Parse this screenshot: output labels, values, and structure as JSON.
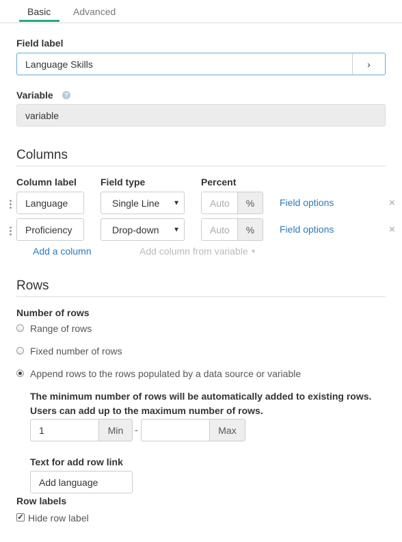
{
  "tabs": {
    "basic": "Basic",
    "advanced": "Advanced"
  },
  "field_label": {
    "label": "Field label",
    "value": "Language Skills",
    "arrow": "›"
  },
  "variable": {
    "label": "Variable",
    "help": "?",
    "value": "variable"
  },
  "columns": {
    "title": "Columns",
    "headers": {
      "column_label": "Column label",
      "field_type": "Field type",
      "percent": "Percent"
    },
    "rows": [
      {
        "label": "Language",
        "type": "Single Line",
        "percent_placeholder": "Auto",
        "percent_unit": "%",
        "options_link": "Field options",
        "remove": "×"
      },
      {
        "label": "Proficiency",
        "type": "Drop-down",
        "percent_placeholder": "Auto",
        "percent_unit": "%",
        "options_link": "Field options",
        "remove": "×"
      }
    ],
    "add_column": "Add a column",
    "add_from_variable": "Add column from variable"
  },
  "rows_section": {
    "title": "Rows",
    "number_label": "Number of rows",
    "options": [
      {
        "label": "Range of rows",
        "checked": false
      },
      {
        "label": "Fixed number of rows",
        "checked": false
      },
      {
        "label": "Append rows to the rows populated by a data source or variable",
        "checked": true
      }
    ],
    "note_line1": "The minimum number of rows will be automatically added to existing rows.",
    "note_line2": "Users can add up to the maximum number of rows.",
    "min_value": "1",
    "min_addon": "Min",
    "separator": "-",
    "max_value": "",
    "max_addon": "Max",
    "add_row_label": "Text for add row link",
    "add_row_value": "Add language",
    "row_labels_label": "Row labels",
    "hide_row_label": "Hide row label",
    "hide_row_checked": true
  }
}
